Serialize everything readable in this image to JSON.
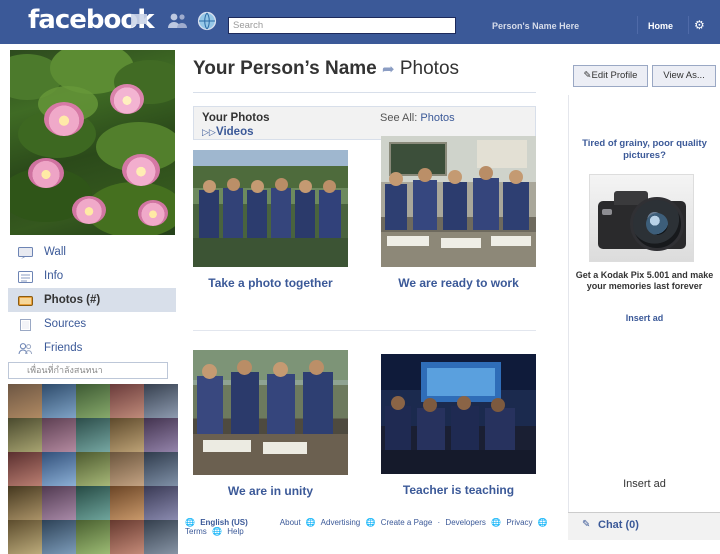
{
  "topbar": {
    "logo": "facebook",
    "icons": [
      "messages-icon",
      "friend-requests-icon",
      "notifications-globe-icon"
    ],
    "search_placeholder": "Search",
    "person_name": "Person's Name Here",
    "home_label": "Home",
    "account_icon": "gear-icon"
  },
  "profile": {
    "title_person": "Your Person’s Name",
    "title_sep_icon": "arrow-icon",
    "title_section": "Photos",
    "edit_profile_label": "Edit Profile",
    "edit_profile_icon": "pencil-icon",
    "view_as_label": "View As..."
  },
  "sidebar": {
    "items": [
      {
        "label": "Wall",
        "icon": "wall-icon",
        "active": false
      },
      {
        "label": "Info",
        "icon": "info-icon",
        "active": false
      },
      {
        "label": "Photos (#)",
        "icon": "photos-icon",
        "active": true
      },
      {
        "label": "Sources",
        "icon": "sources-icon",
        "active": false
      },
      {
        "label": "Friends",
        "icon": "friends-icon",
        "active": false
      }
    ],
    "friend_search_placeholder": "เพื่อนที่กำลังสนทนา",
    "friend_search_icon": "search-icon"
  },
  "photos_bar": {
    "your_photos_label": "Your Photos",
    "videos_label": "Videos",
    "videos_icon": "video-icon",
    "see_all_prefix": "See All:",
    "see_all_link": "Photos"
  },
  "photo_grid": [
    {
      "caption": "Take a photo together",
      "alt": "group-of-students-outdoors"
    },
    {
      "caption": "We are ready to work",
      "alt": "students-at-desks-in-classroom"
    },
    {
      "caption": "We are in unity",
      "alt": "students-working-at-table"
    },
    {
      "caption": "Teacher is teaching",
      "alt": "classroom-with-projector-screen"
    }
  ],
  "ad": {
    "headline": "Tired of grainy, poor quality pictures?",
    "image": "dslr-camera-photo",
    "body": "Get a Kodak Pix 5.001 and make your memories last forever",
    "link": "Insert ad",
    "second_link": "Insert ad"
  },
  "footer": {
    "lang": "English (US)",
    "links": [
      "About",
      "Advertising",
      "Create a Page",
      "Developers",
      "Privacy",
      "Terms",
      "Help"
    ],
    "separator": "·"
  },
  "chat": {
    "label": "Chat (0)",
    "icon": "chat-icon"
  },
  "colors": {
    "brand_blue": "#3b5998",
    "link_blue": "#3b5998",
    "active_nav_bg": "#d8dfea",
    "panel_gray": "#f2f2f2"
  }
}
